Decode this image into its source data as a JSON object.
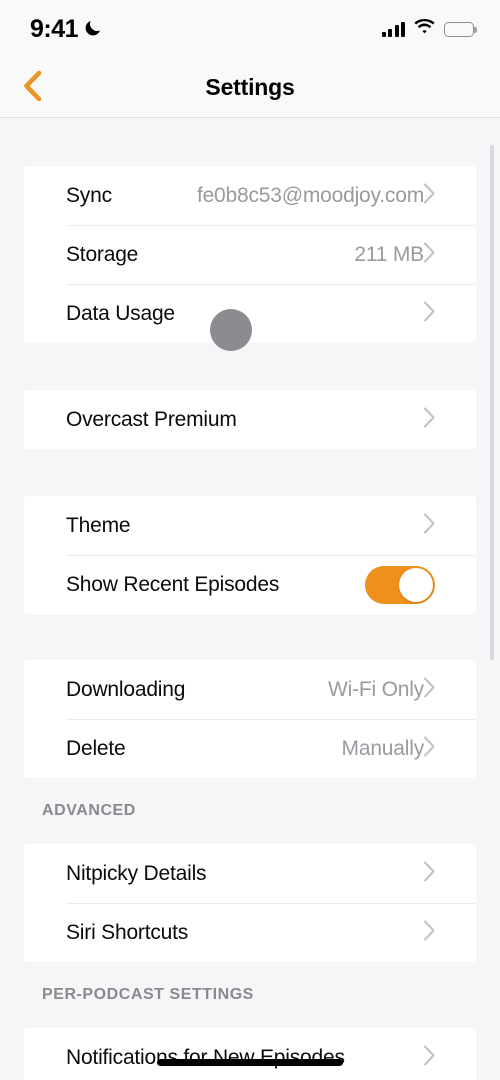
{
  "status_bar": {
    "time": "9:41",
    "dnd_icon": "crescent-moon-icon",
    "cellular_icon": "cellular-signal-icon",
    "wifi_icon": "wifi-icon",
    "battery_icon": "battery-full-icon"
  },
  "nav": {
    "back_icon": "chevron-left-icon",
    "title": "Settings"
  },
  "colors": {
    "accent": "#ef8f1c",
    "back_chevron": "#e8962a",
    "page_background": "#f6f6f8",
    "card_background": "#ffffff",
    "primary_text": "#0b0b0b",
    "secondary_text": "#9a9aa0",
    "section_header_text": "#8a8a8e",
    "separator": "#ececef",
    "toggle_on": "#ef8f1c",
    "touch_indicator": "#8b8b90"
  },
  "groups": [
    {
      "name": "account-group",
      "header": null,
      "rows": [
        {
          "name": "sync",
          "label": "Sync",
          "value": "fe0b8c53@moodjoy.com",
          "accessory": "chevron"
        },
        {
          "name": "storage",
          "label": "Storage",
          "value": "211 MB",
          "accessory": "chevron"
        },
        {
          "name": "data-usage",
          "label": "Data Usage",
          "value": "",
          "accessory": "chevron"
        }
      ]
    },
    {
      "name": "premium-group",
      "header": null,
      "rows": [
        {
          "name": "overcast-premium",
          "label": "Overcast Premium",
          "value": "",
          "accessory": "chevron"
        }
      ]
    },
    {
      "name": "appearance-group",
      "header": null,
      "rows": [
        {
          "name": "theme",
          "label": "Theme",
          "value": "",
          "accessory": "chevron"
        },
        {
          "name": "show-recent-episodes",
          "label": "Show Recent Episodes",
          "value": "",
          "accessory": "toggle",
          "toggle_on": true
        }
      ]
    },
    {
      "name": "downloads-group",
      "header": null,
      "rows": [
        {
          "name": "downloading",
          "label": "Downloading",
          "value": "Wi-Fi Only",
          "accessory": "chevron"
        },
        {
          "name": "delete",
          "label": "Delete",
          "value": "Manually",
          "accessory": "chevron"
        }
      ]
    },
    {
      "name": "advanced-group",
      "header": "ADVANCED",
      "rows": [
        {
          "name": "nitpicky-details",
          "label": "Nitpicky Details",
          "value": "",
          "accessory": "chevron"
        },
        {
          "name": "siri-shortcuts",
          "label": "Siri Shortcuts",
          "value": "",
          "accessory": "chevron"
        }
      ]
    },
    {
      "name": "per-podcast-group",
      "header": "PER-PODCAST SETTINGS",
      "rows": [
        {
          "name": "notifications-for-new-episodes",
          "label": "Notifications for New Episodes",
          "value": "",
          "accessory": "chevron"
        }
      ]
    }
  ],
  "scrollbar": {
    "name": "vertical-scrollbar"
  },
  "touch_indicator": {
    "name": "touch-indicator"
  },
  "home_indicator": {
    "name": "home-indicator"
  }
}
